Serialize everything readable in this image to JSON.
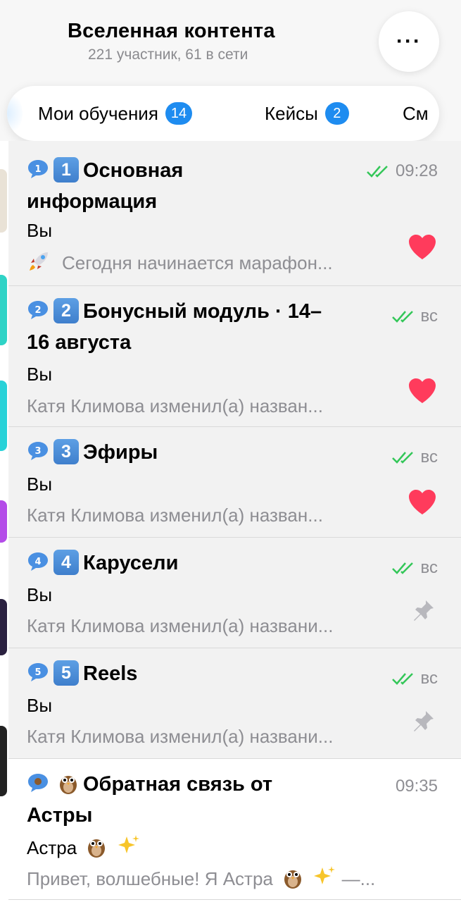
{
  "header": {
    "title": "Вселенная контента",
    "subtitle": "221 участник, 61 в сети",
    "more_icon": "ellipsis-icon"
  },
  "tabs": [
    {
      "label": "Мои обучения",
      "badge": "14"
    },
    {
      "label": "Кейсы",
      "badge": "2"
    },
    {
      "label": "См"
    }
  ],
  "chats": [
    {
      "title_line1": "Основная",
      "title_line2": "информация",
      "key": "1",
      "time": "09:28",
      "sender": "Вы",
      "preview": "Сегодня начинается марафон...",
      "preview_icon": "rocket-icon",
      "status": "read",
      "side_icon": "heart-icon"
    },
    {
      "title_line1": "Бонусный модуль · 14–",
      "title_line2": "16 августа",
      "key": "2",
      "time": "вс",
      "sender": "Вы",
      "preview": "Катя Климова изменил(а) назван...",
      "status": "read",
      "side_icon": "heart-icon"
    },
    {
      "title_line1": "Эфиры",
      "key": "3",
      "time": "вс",
      "sender": "Вы",
      "preview": "Катя Климова изменил(а) назван...",
      "status": "read",
      "side_icon": "heart-icon"
    },
    {
      "title_line1": "Карусели",
      "key": "4",
      "time": "вс",
      "sender": "Вы",
      "preview": "Катя Климова изменил(а) названи...",
      "status": "read",
      "side_icon": "pin-icon"
    },
    {
      "title_line1": "Reels",
      "key": "5",
      "time": "вс",
      "sender": "Вы",
      "preview": "Катя Климова изменил(а) названи...",
      "status": "read",
      "side_icon": "pin-icon"
    },
    {
      "title_line1": "Обратная связь от",
      "title_line2": "Астры",
      "time": "09:35",
      "sender": "Астра",
      "preview_a": "Привет, волшебные! Я Астра",
      "preview_b": "—...",
      "title_icon": "owl-icon",
      "sender_icons": [
        "owl-icon",
        "sparkles-icon"
      ]
    }
  ],
  "colors": {
    "accent": "#1e8cf0",
    "check": "#34c759",
    "heart": "#ff3b5c",
    "muted": "#8e8e93"
  }
}
